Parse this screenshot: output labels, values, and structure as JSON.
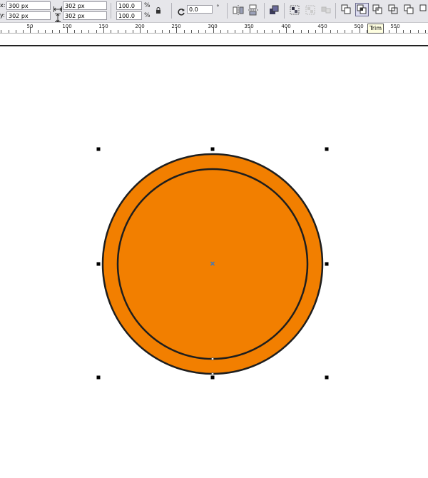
{
  "toolbar": {
    "x_label": "x:",
    "x_value": "300 px",
    "y_label": "y:",
    "y_value": "302 px",
    "width_value": "302 px",
    "height_value": "302 px",
    "scale_x_value": "100.0",
    "scale_y_value": "100.0",
    "percent_unit": "%",
    "rotation_value": "0.0",
    "degree_unit": "°",
    "active_button": "trim-button"
  },
  "tooltip": {
    "text": "Trim"
  },
  "ruler": {
    "ticks": [
      "50",
      "100",
      "150",
      "200",
      "250",
      "300",
      "350",
      "400",
      "450",
      "500",
      "550"
    ]
  },
  "colors": {
    "fill": "#f27f00",
    "stroke": "#1e1e1e",
    "handle": "#000000",
    "center_marker": "#3a78c2"
  }
}
